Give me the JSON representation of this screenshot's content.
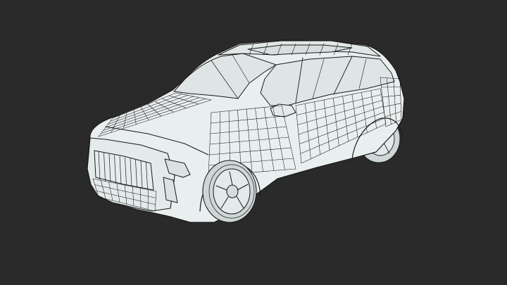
{
  "scene": {
    "background": "#2a2a2a",
    "subject": "wireframe-suv-model",
    "surface_color": "#e9eeee",
    "wire_color": "#1a1a1a",
    "glass_color": "#dfe5e5",
    "tire_color": "#cfd6d6"
  }
}
